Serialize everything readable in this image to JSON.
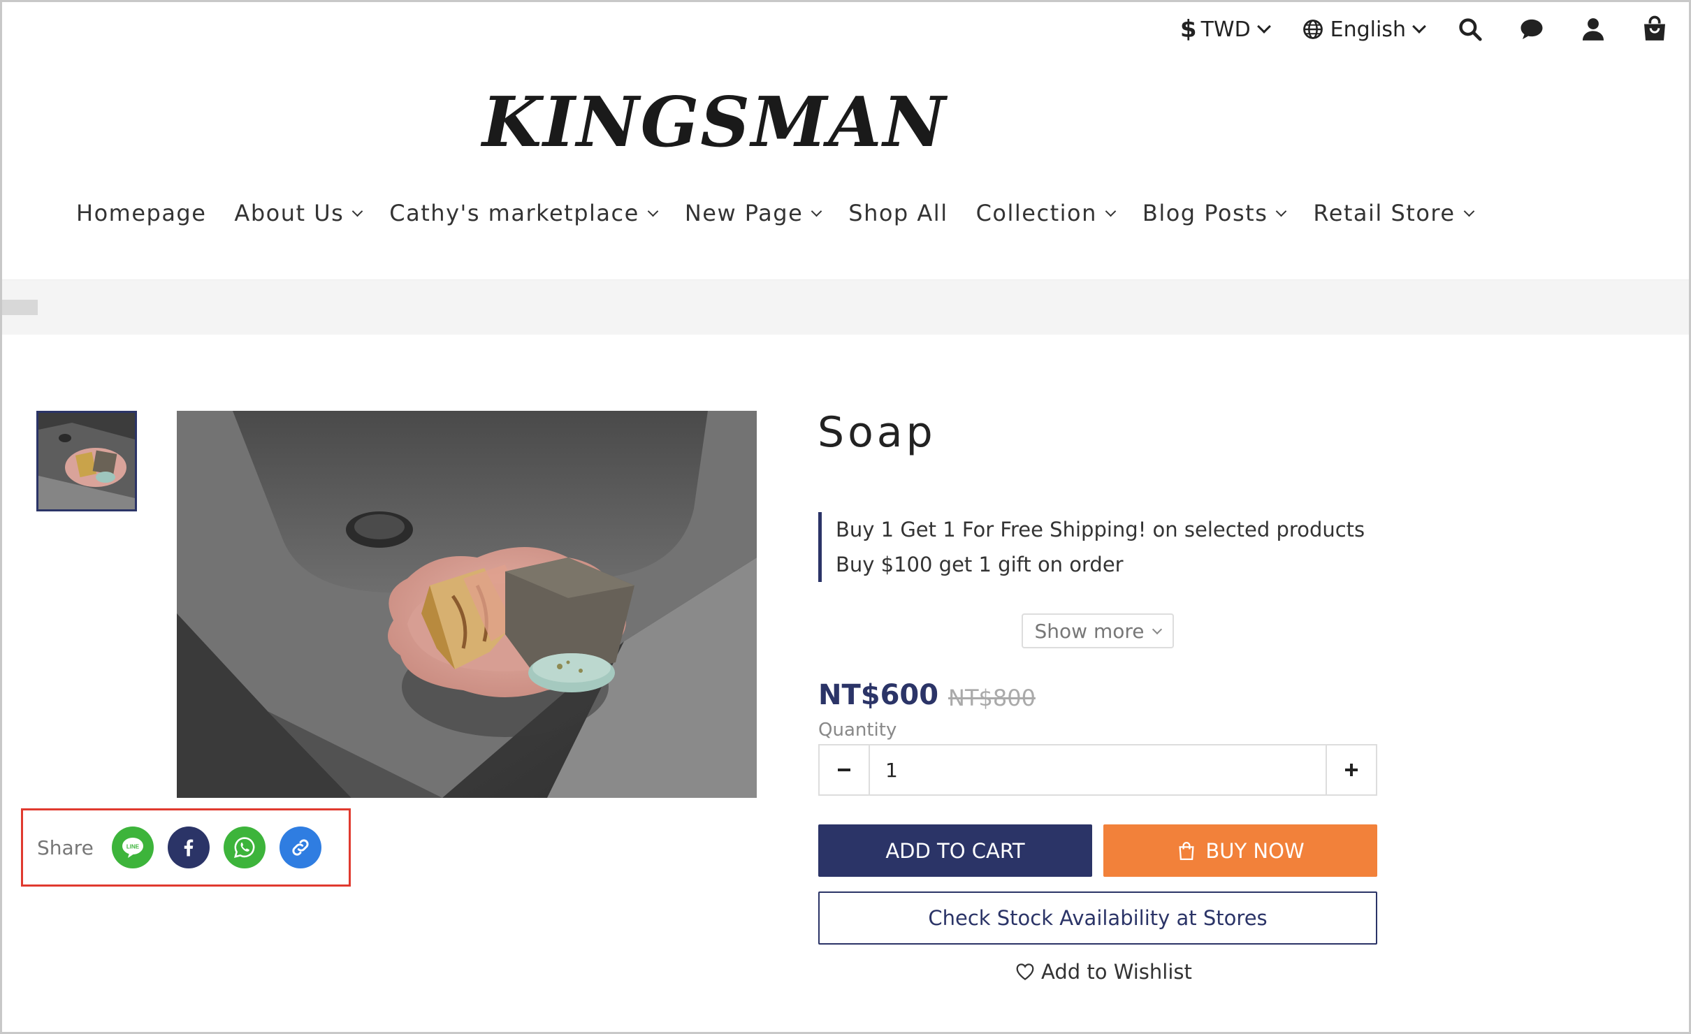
{
  "header": {
    "currency": {
      "symbol": "$",
      "label": "TWD"
    },
    "language": {
      "label": "English"
    },
    "icons": [
      "search-icon",
      "chat-icon",
      "user-icon",
      "cart-icon"
    ]
  },
  "logo": {
    "text": "KINGSMAN"
  },
  "nav": {
    "items": [
      {
        "label": "Homepage",
        "dropdown": false
      },
      {
        "label": "About Us",
        "dropdown": true
      },
      {
        "label": "Cathy's marketplace",
        "dropdown": true
      },
      {
        "label": "New Page",
        "dropdown": true
      },
      {
        "label": "Shop All",
        "dropdown": false
      },
      {
        "label": "Collection",
        "dropdown": true
      },
      {
        "label": "Blog Posts",
        "dropdown": true
      },
      {
        "label": "Retail Store",
        "dropdown": true
      }
    ]
  },
  "product": {
    "title": "Soap",
    "promotions": [
      "Buy 1 Get 1 For Free Shipping! on selected products",
      "Buy $100 get 1 gift on order"
    ],
    "show_more": "Show more",
    "price": "NT$600",
    "original_price": "NT$800",
    "quantity_label": "Quantity",
    "quantity": "1",
    "add_to_cart": "ADD TO CART",
    "buy_now": "BUY NOW",
    "check_stock": "Check Stock Availability at Stores",
    "wishlist": "Add to Wishlist"
  },
  "share": {
    "label": "Share",
    "buttons": [
      {
        "name": "line",
        "color": "#3db43b"
      },
      {
        "name": "facebook",
        "color": "#2b3467"
      },
      {
        "name": "whatsapp",
        "color": "#3db43b"
      },
      {
        "name": "copy-link",
        "color": "#2f7de1"
      }
    ],
    "line_text": "LINE"
  },
  "colors": {
    "accent": "#2b3467",
    "buy_now": "#f2813a",
    "highlight_box": "#e03a2f"
  }
}
